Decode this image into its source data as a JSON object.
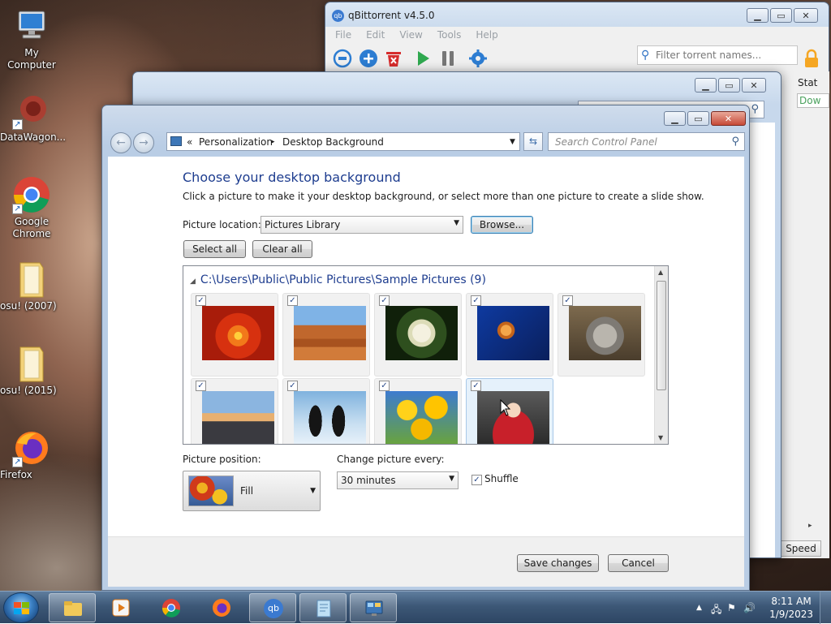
{
  "desktop": {
    "icons": [
      {
        "label": "My Computer"
      },
      {
        "label": "DataWagon..."
      },
      {
        "label": "Google Chrome"
      },
      {
        "label": "osu! (2007)"
      },
      {
        "label": "osu! (2015)"
      },
      {
        "label": "Firefox"
      }
    ]
  },
  "qbittorrent": {
    "title": "qBittorrent v4.5.0",
    "logo_text": "qb",
    "menu": [
      "File",
      "Edit",
      "View",
      "Tools",
      "Help"
    ],
    "filter_placeholder": "Filter torrent names...",
    "column_header": "Stat",
    "status_cell": "Dow",
    "speed_button": "Speed",
    "status_color": "#4aa15d"
  },
  "personalization": {
    "breadcrumb": {
      "prefix": "«",
      "item1": "Personalization",
      "separator": "▸",
      "item2": "Desktop Background"
    },
    "search_placeholder": "Search Control Panel",
    "heading": "Choose your desktop background",
    "subtitle": "Click a picture to make it your desktop background, or select more than one picture to create a slide show.",
    "picture_location_label": "Picture location:",
    "picture_location_value": "Pictures Library",
    "browse_button": "Browse...",
    "select_all_button": "Select all",
    "clear_all_button": "Clear all",
    "gallery_path": "C:\\Users\\Public\\Public Pictures\\Sample Pictures (9)",
    "pictures": [
      {
        "name": "chrysanthemum",
        "checked": "✓"
      },
      {
        "name": "desert",
        "checked": "✓"
      },
      {
        "name": "hydrangeas",
        "checked": "✓"
      },
      {
        "name": "jellyfish",
        "checked": "✓"
      },
      {
        "name": "koala",
        "checked": "✓"
      },
      {
        "name": "lighthouse",
        "checked": "✓"
      },
      {
        "name": "penguins",
        "checked": "✓"
      },
      {
        "name": "tulips",
        "checked": "✓"
      },
      {
        "name": "santa",
        "checked": "✓"
      }
    ],
    "picture_position_label": "Picture position:",
    "picture_position_value": "Fill",
    "change_every_label": "Change picture every:",
    "change_every_value": "30 minutes",
    "shuffle_label": "Shuffle",
    "shuffle_checked": "✓",
    "save_button": "Save changes",
    "cancel_button": "Cancel",
    "accent_color": "#1e3d8f"
  },
  "taskbar": {
    "time": "8:11 AM",
    "date": "1/9/2023",
    "qb_text": "qb"
  }
}
